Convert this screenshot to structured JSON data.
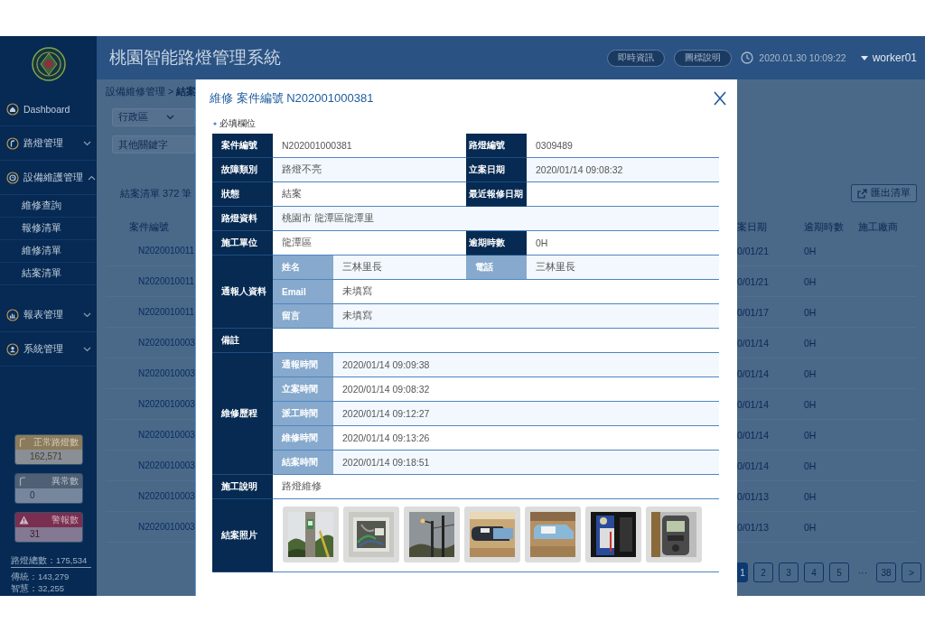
{
  "header": {
    "title": "桃園智能路燈管理系統",
    "buttons": [
      "即時資訊",
      "圖標說明"
    ],
    "datetime": "2020.01.30 10:09:22",
    "user": "worker01"
  },
  "sidebar": {
    "items": [
      {
        "label": "Dashboard",
        "kind": "link"
      },
      {
        "label": "路燈管理",
        "kind": "group",
        "expanded": false
      },
      {
        "label": "設備維護管理",
        "kind": "group",
        "expanded": true,
        "children": [
          {
            "label": "維修查詢"
          },
          {
            "label": "報修清單"
          },
          {
            "label": "維修清單"
          },
          {
            "label": "結案清單"
          }
        ]
      },
      {
        "label": "報表管理",
        "kind": "group",
        "expanded": false
      },
      {
        "label": "系統管理",
        "kind": "group",
        "expanded": false
      }
    ],
    "stats": [
      {
        "label": "正常路燈數",
        "value": "162,571",
        "kind": "lamp",
        "color": "#8c7b5a"
      },
      {
        "label": "異常數",
        "value": "0",
        "kind": "lamp",
        "color": "#4f6075"
      },
      {
        "label": "警報數",
        "value": "31",
        "kind": "alert",
        "color": "#7a2f50"
      }
    ],
    "totals": [
      "路燈總數：175,534",
      "傳統：143,279",
      "智慧：32,255"
    ]
  },
  "background": {
    "breadcrumb": "設備維修管理 > **結案**",
    "district_select": "行政區",
    "keyword_placeholder": "其他關鍵字",
    "list_title": "結案清單 372 筆",
    "export_button": "匯出清單",
    "columns": [
      "案件編號",
      "案日期",
      "逾期時數",
      "施工廠商"
    ],
    "rows": [
      {
        "case": "N2020010011",
        "date": "0/01/21",
        "overdue": "0H"
      },
      {
        "case": "N2020010011",
        "date": "0/01/21",
        "overdue": "0H"
      },
      {
        "case": "N2020010011",
        "date": "0/01/17",
        "overdue": "0H"
      },
      {
        "case": "N2020010003",
        "date": "0/01/14",
        "overdue": "0H"
      },
      {
        "case": "N2020010003",
        "date": "0/01/14",
        "overdue": "0H"
      },
      {
        "case": "N2020010003",
        "date": "0/01/14",
        "overdue": "0H"
      },
      {
        "case": "N2020010003",
        "date": "0/01/14",
        "overdue": "0H"
      },
      {
        "case": "N2020010003",
        "date": "0/01/14",
        "overdue": "0H"
      },
      {
        "case": "N2020010003",
        "date": "0/01/13",
        "overdue": "0H"
      },
      {
        "case": "N2020010003",
        "date": "0/01/13",
        "overdue": "0H"
      }
    ],
    "pages": [
      {
        "label": "1",
        "kind": "page",
        "selected": true
      },
      {
        "label": "2",
        "kind": "page",
        "selected": false
      },
      {
        "label": "3",
        "kind": "page",
        "selected": false
      },
      {
        "label": "4",
        "kind": "page",
        "selected": false
      },
      {
        "label": "5",
        "kind": "page",
        "selected": false
      },
      {
        "label": "···",
        "kind": "gap",
        "selected": false
      },
      {
        "label": "38",
        "kind": "page",
        "selected": false
      },
      {
        "label": ">",
        "kind": "page",
        "selected": false
      }
    ]
  },
  "modal": {
    "title": "維修 案件編號 N202001000381",
    "required_note": "必填欄位",
    "rows": [
      {
        "kind": "pair",
        "cells": [
          {
            "label": "案件編號",
            "value": "N202001000381"
          },
          {
            "label": "路燈編號",
            "value": "0309489"
          }
        ]
      },
      {
        "kind": "pair",
        "cells": [
          {
            "label": "故障類別",
            "value": "路燈不亮"
          },
          {
            "label": "立案日期",
            "value": "2020/01/14 09:08:32"
          }
        ]
      },
      {
        "kind": "pair",
        "cells": [
          {
            "label": "狀態",
            "value": "結案"
          },
          {
            "label": "最近報修日期"
          }
        ]
      },
      {
        "kind": "wide",
        "label": "路燈資料",
        "value": "桃園市 龍潭區龍潭里"
      },
      {
        "kind": "pair",
        "cells": [
          {
            "label": "施工單位",
            "value": "龍潭區"
          },
          {
            "label": "逾期時數",
            "value": "0H"
          }
        ]
      },
      {
        "kind": "group",
        "label": "通報人資料",
        "rows": [
          {
            "kind": "pair",
            "cells": [
              {
                "label": "姓名",
                "value": "三林里長"
              },
              {
                "label": "電話",
                "value": "三林里長"
              }
            ]
          },
          {
            "kind": "wide",
            "label": "Email",
            "value": "未填寫"
          },
          {
            "kind": "wide",
            "label": "留言",
            "value": "未填寫"
          }
        ]
      },
      {
        "kind": "wide",
        "label": "備註"
      },
      {
        "kind": "group",
        "label": "維修歷程",
        "rows": [
          {
            "kind": "wide",
            "label": "通報時間",
            "value": "2020/01/14 09:09:38"
          },
          {
            "kind": "wide",
            "label": "立案時間",
            "value": "2020/01/14 09:08:32"
          },
          {
            "kind": "wide",
            "label": "派工時間",
            "value": "2020/01/14 09:12:27"
          },
          {
            "kind": "wide",
            "label": "維修時間",
            "value": "2020/01/14 09:13:26"
          },
          {
            "kind": "wide",
            "label": "結案時間",
            "value": "2020/01/14 09:18:51"
          }
        ]
      },
      {
        "kind": "wide",
        "label": "施工說明",
        "value": "路燈維修"
      },
      {
        "kind": "photos",
        "label": "結案照片"
      }
    ]
  }
}
